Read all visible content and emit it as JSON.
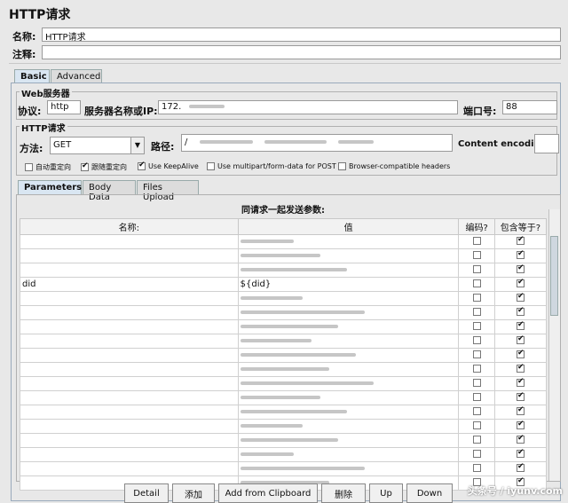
{
  "header": {
    "title": "HTTP请求",
    "name_label": "名称:",
    "name_value": "HTTP请求",
    "comment_label": "注释:"
  },
  "tabs": [
    {
      "label": "Basic"
    },
    {
      "label": "Advanced"
    }
  ],
  "web_server": {
    "group_title": "Web服务器",
    "protocol_label": "协议:",
    "protocol_value": "http",
    "server_label": "服务器名称或IP:",
    "server_value": "172.",
    "port_label": "端口号:",
    "port_value": "88"
  },
  "http_request": {
    "group_title": "HTTP请求",
    "method_label": "方法:",
    "method_value": "GET",
    "path_label": "路径:",
    "path_value": "/",
    "encoding_label": "Content encoding:",
    "options": [
      {
        "label": "自动重定向",
        "checked": false
      },
      {
        "label": "跟随重定向",
        "checked": true
      },
      {
        "label": "Use KeepAlive",
        "checked": true
      },
      {
        "label": "Use multipart/form-data for POST",
        "checked": false
      },
      {
        "label": "Browser-compatible headers",
        "checked": false
      }
    ]
  },
  "sub_tabs": [
    {
      "label": "Parameters"
    },
    {
      "label": "Body Data"
    },
    {
      "label": "Files Upload"
    }
  ],
  "params": {
    "caption": "同请求一起发送参数:",
    "columns": [
      "名称:",
      "值",
      "编码?",
      "包含等于?"
    ],
    "rows": [
      {
        "name": "",
        "value": ""
      },
      {
        "name": "",
        "value": ""
      },
      {
        "name": "",
        "value": ""
      },
      {
        "name": "did",
        "value": "${did}"
      },
      {
        "name": "",
        "value": ""
      },
      {
        "name": "",
        "value": ""
      },
      {
        "name": "",
        "value": ""
      },
      {
        "name": "",
        "value": ""
      },
      {
        "name": "",
        "value": ""
      },
      {
        "name": "",
        "value": ""
      },
      {
        "name": "",
        "value": ""
      },
      {
        "name": "",
        "value": ""
      },
      {
        "name": "",
        "value": ""
      },
      {
        "name": "",
        "value": ""
      },
      {
        "name": "",
        "value": ""
      },
      {
        "name": "",
        "value": ""
      },
      {
        "name": "",
        "value": ""
      },
      {
        "name": "",
        "value": ""
      }
    ]
  },
  "buttons": {
    "detail": "Detail",
    "add": "添加",
    "add_clipboard": "Add from Clipboard",
    "delete": "删除",
    "up": "Up",
    "down": "Down"
  },
  "watermark": "头条号 / iyunv.com"
}
